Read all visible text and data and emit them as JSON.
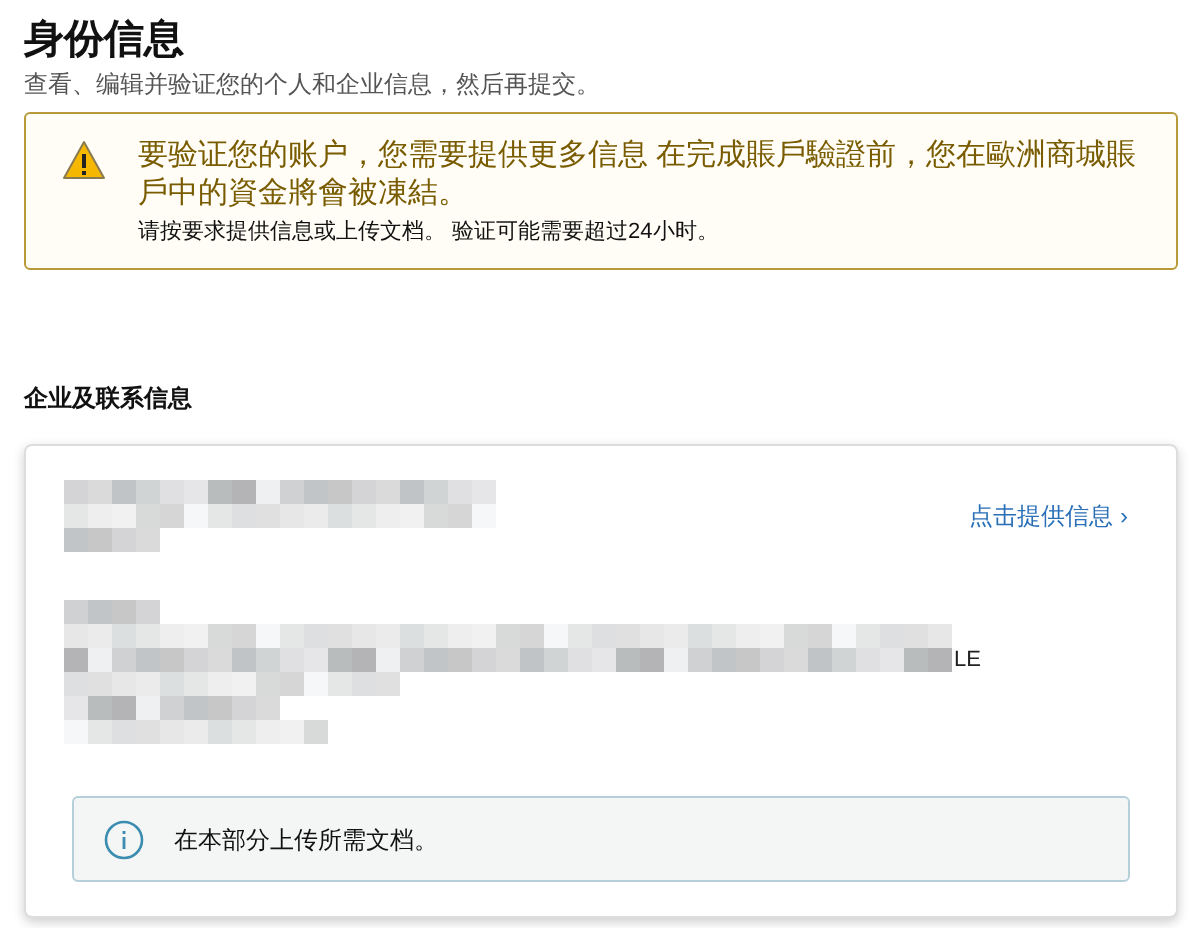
{
  "page": {
    "title": "身份信息",
    "subtitle": "查看、编辑并验证您的个人和企业信息，然后再提交。"
  },
  "alert": {
    "kind": "warning",
    "heading": "要验证您的账户，您需要提供更多信息 在完成賬戶驗證前，您在歐洲商城賬戶中的資金將會被凍結。",
    "message": "请按要求提供信息或上传文档。 验证可能需要超过24小时。"
  },
  "section": {
    "heading": "企业及联系信息",
    "card": {
      "blocks": [
        {
          "kind": "redacted"
        },
        {
          "kind": "redacted",
          "trailing_text": "LE"
        }
      ],
      "link": "点击提供信息 ›",
      "notice": {
        "kind": "info",
        "text": "在本部分上传所需文档。"
      }
    }
  }
}
